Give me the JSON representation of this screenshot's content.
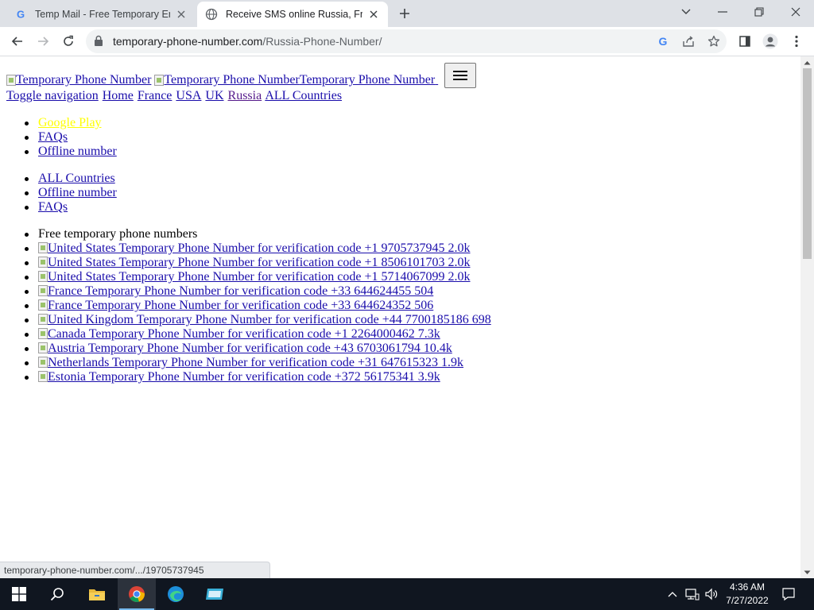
{
  "browser": {
    "tabs": [
      {
        "title": "Temp Mail - Free Temporary Ema",
        "active": false
      },
      {
        "title": "Receive SMS online Russia, Free",
        "active": true
      }
    ],
    "url_host": "temporary-phone-number.com",
    "url_path": "/Russia-Phone-Number/",
    "status_text": "temporary-phone-number.com/.../19705737945"
  },
  "page": {
    "brand_alt_1": "Temporary Phone Number",
    "brand_alt_2": "Temporary Phone Number",
    "brand_text": "Temporary Phone Number",
    "nav": {
      "toggle": "Toggle navigation",
      "home": "Home",
      "france": "France",
      "usa": "USA",
      "uk": "UK",
      "russia": "Russia",
      "all": "ALL Countries"
    },
    "menu1": [
      "Google Play",
      "FAQs",
      "Offline number"
    ],
    "menu2": [
      "ALL Countries",
      "Offline number",
      "FAQs"
    ],
    "numbers_heading": "Free temporary phone numbers",
    "numbers": [
      "United States Temporary Phone Number for verification code +1 9705737945 2.0k",
      "United States Temporary Phone Number for verification code +1 8506101703 2.0k",
      "United States Temporary Phone Number for verification code +1 5714067099 2.0k",
      "France Temporary Phone Number for verification code +33 644624455 504",
      "France Temporary Phone Number for verification code +33 644624352 506",
      "United Kingdom Temporary Phone Number for verification code +44 7700185186 698",
      "Canada Temporary Phone Number for verification code +1 2264000462 7.3k",
      "Austria Temporary Phone Number for verification code +43 6703061794 10.4k",
      "Netherlands Temporary Phone Number for verification code +31 647615323 1.9k",
      "Estonia Temporary Phone Number for verification code +372 56175341 3.9k"
    ]
  },
  "taskbar": {
    "time": "4:36 AM",
    "date": "7/27/2022"
  },
  "colors": {
    "link": "#1a0dab",
    "google_play_link": "#ffff00",
    "taskbar": "#101620",
    "tabstrip": "#dee1e6"
  }
}
